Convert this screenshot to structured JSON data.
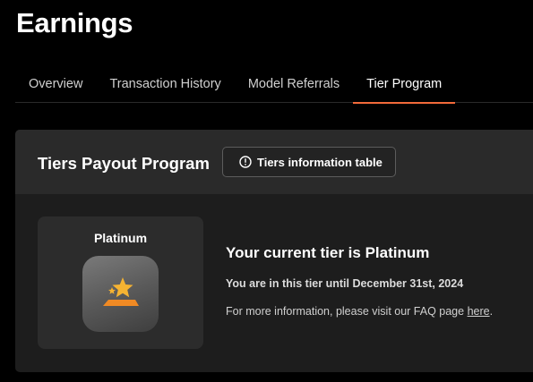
{
  "page": {
    "title": "Earnings"
  },
  "tabs": [
    {
      "label": "Overview",
      "active": false
    },
    {
      "label": "Transaction History",
      "active": false
    },
    {
      "label": "Model Referrals",
      "active": false
    },
    {
      "label": "Tier Program",
      "active": true
    }
  ],
  "tier_card": {
    "title": "Tiers Payout Program",
    "info_button_label": "Tiers information table",
    "info_icon": "exclamation-circle-icon",
    "tier_name": "Platinum",
    "badge_icon": "star-podium-icon",
    "current_tier_prefix": "Your current tier is ",
    "current_tier_value": "Platinum",
    "until_text": "You are in this tier until December 31st, 2024",
    "faq_prefix": "For more information, please visit our FAQ page ",
    "faq_link": "here",
    "faq_suffix": "."
  },
  "colors": {
    "background": "#000000",
    "card": "#1d1d1d",
    "card_header": "#2a2a2a",
    "accent_tab_underline": "#f26a3a",
    "badge_star": "#f5b332",
    "badge_podium": "#f08a24"
  }
}
